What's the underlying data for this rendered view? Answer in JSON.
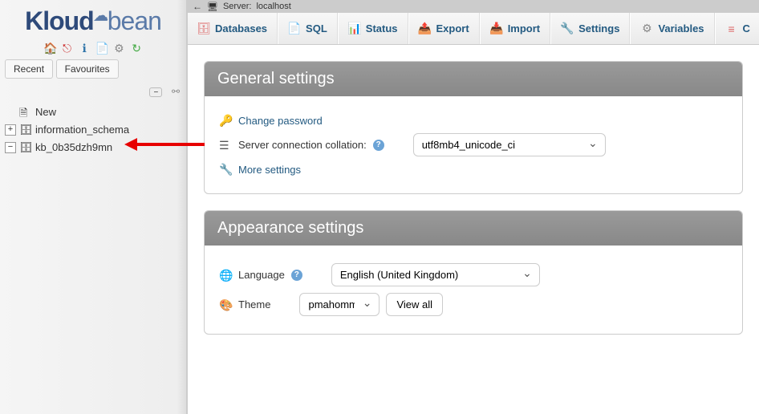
{
  "logo": {
    "brand1": "Kloud",
    "brand2": "bean"
  },
  "sidebar": {
    "tabs": {
      "recent": "Recent",
      "favourites": "Favourites"
    },
    "tree": [
      {
        "label": "New",
        "toggle": null
      },
      {
        "label": "information_schema",
        "toggle": "+"
      },
      {
        "label": "kb_0b35dzh9mn",
        "toggle": "−"
      }
    ]
  },
  "breadcrumb": {
    "server_label": "Server:",
    "server_value": "localhost"
  },
  "tabs": [
    {
      "label": "Databases"
    },
    {
      "label": "SQL"
    },
    {
      "label": "Status"
    },
    {
      "label": "Export"
    },
    {
      "label": "Import"
    },
    {
      "label": "Settings"
    },
    {
      "label": "Variables"
    },
    {
      "label": "C"
    }
  ],
  "general": {
    "title": "General settings",
    "change_password": "Change password",
    "collation_label": "Server connection collation:",
    "collation_value": "utf8mb4_unicode_ci",
    "more_settings": "More settings"
  },
  "appearance": {
    "title": "Appearance settings",
    "language_label": "Language",
    "language_value": "English (United Kingdom)",
    "theme_label": "Theme",
    "theme_value": "pmahomme",
    "view_all": "View all"
  }
}
